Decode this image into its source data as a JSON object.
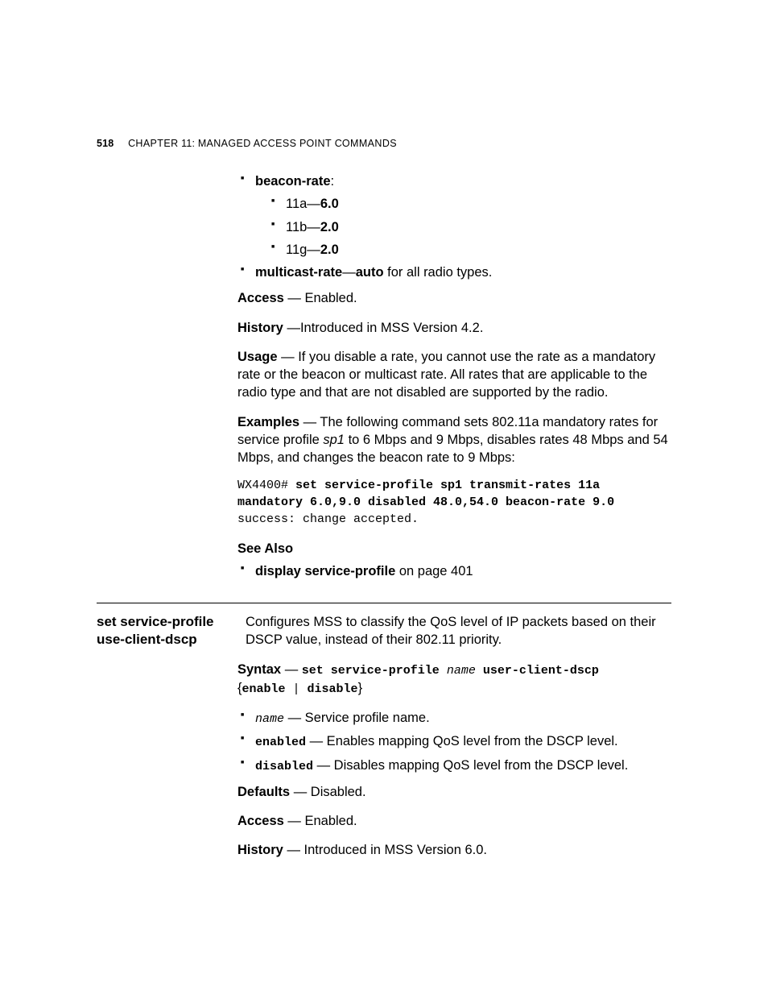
{
  "page_number": "518",
  "chapter_label_html": "C<span class='sc'>HAPTER</span> 11: M<span class='sc'>ANAGED</span> A<span class='sc'>CCESS</span> P<span class='sc'>OINT</span> C<span class='sc'>OMMANDS</span>",
  "beacon_rate_label": "beacon-rate",
  "beacon_rate_colon": ":",
  "beacon_11a_pre": "11a—",
  "beacon_11a_val": "6.0",
  "beacon_11b_pre": "11b—",
  "beacon_11b_val": "2.0",
  "beacon_11g_pre": "11g—",
  "beacon_11g_val": "2.0",
  "multicast_rate_label": "multicast-rate",
  "multicast_rate_dash": "—",
  "multicast_rate_val": "auto",
  "multicast_rate_suffix": " for all radio types.",
  "access_label": "Access",
  "access_text": " — Enabled.",
  "history_label": "History",
  "history_text": " —Introduced in MSS Version 4.2.",
  "usage_label": "Usage",
  "usage_text": " — If you disable a rate, you cannot use the rate as a mandatory rate or the beacon or multicast rate. All rates that are applicable to the radio type and that are not disabled are supported by the radio.",
  "examples_label": "Examples",
  "examples_text_pre": " — The following command sets 802.11a mandatory rates for service profile ",
  "examples_sp1": "sp1",
  "examples_text_post": " to 6 Mbps and 9 Mbps, disables rates 48 Mbps and 54 Mbps, and changes the beacon rate to 9 Mbps:",
  "code_prompt": "WX4400# ",
  "code_cmd": "set service-profile sp1 transmit-rates 11a mandatory 6.0,9.0 disabled 48.0,54.0 beacon-rate 9.0",
  "code_result": "success: change accepted.",
  "see_also_heading": "See Also",
  "see_also_item_bold": "display service-profile",
  "see_also_item_suffix": " on page 401",
  "sec2_title": "set service-profile use-client-dscp",
  "sec2_desc": "Configures MSS to classify the QoS level of IP packets based on their DSCP value, instead of their 802.11 priority.",
  "sec2_syntax_label": "Syntax",
  "sec2_syntax_dash": " — ",
  "sec2_syntax_cmd_pre": "set service-profile ",
  "sec2_syntax_name": "name",
  "sec2_syntax_cmd_post": " user-client-dscp",
  "sec2_syntax_braces_open": "{",
  "sec2_syntax_enable": "enable",
  "sec2_syntax_pipe": " | ",
  "sec2_syntax_disable": "disable",
  "sec2_syntax_braces_close": "}",
  "sec2_param_name_code": "name",
  "sec2_param_name_text": " — Service profile name.",
  "sec2_param_enabled_code": "enabled",
  "sec2_param_enabled_text": " — Enables mapping QoS level from the DSCP level.",
  "sec2_param_disabled_code": "disabled",
  "sec2_param_disabled_text": " — Disables mapping QoS level from the DSCP level.",
  "sec2_defaults_label": "Defaults",
  "sec2_defaults_text": " — Disabled.",
  "sec2_access_label": "Access",
  "sec2_access_text": " —  Enabled.",
  "sec2_history_label": "History",
  "sec2_history_text": " — Introduced in MSS Version 6.0."
}
